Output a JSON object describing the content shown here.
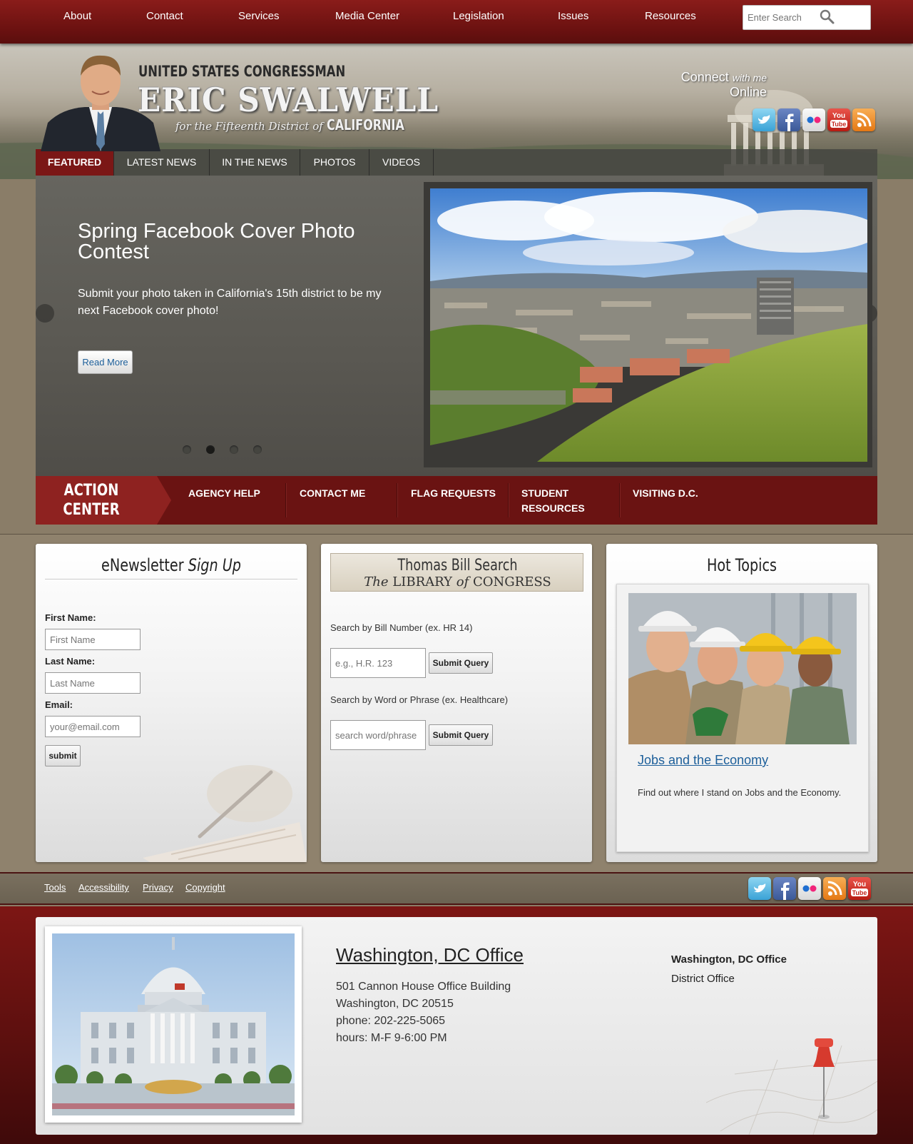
{
  "topnav": {
    "items": [
      "About",
      "Contact",
      "Services",
      "Media Center",
      "Legislation",
      "Issues",
      "Resources"
    ],
    "search_placeholder": "Enter Search"
  },
  "header": {
    "title_line": "UNITED STATES CONGRESSMAN",
    "name": "ERIC SWALWELL",
    "district_prefix": "for the Fifteenth District of",
    "district_state": "CALIFORNIA",
    "connect_word": "Connect",
    "connect_with": "with me",
    "connect_online": "Online",
    "social_icons": [
      "twitter-icon",
      "facebook-icon",
      "flickr-icon",
      "youtube-icon",
      "rss-icon"
    ]
  },
  "tabs": [
    "FEATURED",
    "LATEST NEWS",
    "IN THE NEWS",
    "PHOTOS",
    "VIDEOS"
  ],
  "slider": {
    "title": "Spring Facebook Cover Photo Contest",
    "text": "Submit your photo taken in California's 15th district to be my next Facebook cover photo!",
    "button": "Read More",
    "dot_count": 4,
    "active_dot": 2
  },
  "action_center": {
    "badge_line1": "ACTION",
    "badge_line2": "CENTER",
    "links": [
      "AGENCY HELP",
      "CONTACT ME",
      "FLAG REQUESTS",
      "STUDENT RESOURCES",
      "VISITING D.C."
    ]
  },
  "newsletter": {
    "heading_plain": "eNewsletter",
    "heading_italic": "Sign Up",
    "first_label": "First Name:",
    "first_placeholder": "First Name",
    "last_label": "Last Name:",
    "last_placeholder": "Last Name",
    "email_label": "Email:",
    "email_placeholder": "your@email.com",
    "submit": "submit"
  },
  "thomas": {
    "title": "Thomas Bill Search",
    "sub_the": "The",
    "sub_library": "LIBRARY",
    "sub_of": "of",
    "sub_congress": "CONGRESS",
    "bill_label": "Search by Bill Number (ex. HR 14)",
    "bill_placeholder": "e.g., H.R. 123",
    "word_label": "Search by Word or Phrase (ex. Healthcare)",
    "word_placeholder": "search word/phrase",
    "submit": "Submit Query"
  },
  "hot_topics": {
    "heading": "Hot Topics",
    "link": "Jobs and the Economy",
    "desc": "Find out where I stand on Jobs and the Economy."
  },
  "footer": {
    "links": [
      "Tools",
      "Accessibility",
      "Privacy",
      "Copyright"
    ],
    "social_icons": [
      "twitter-icon",
      "facebook-icon",
      "flickr-icon",
      "rss-icon",
      "youtube-icon"
    ]
  },
  "office": {
    "title": "Washington, DC Office",
    "address1": "501 Cannon House Office Building",
    "address2": "Washington, DC 20515",
    "phone": "phone: 202-225-5065",
    "hours": "hours: M-F 9-6:00 PM",
    "tab_active": "Washington, DC Office",
    "tab_other": "District Office"
  },
  "colors": {
    "maroon": "#6a1312",
    "link_blue": "#1d5f9a"
  }
}
